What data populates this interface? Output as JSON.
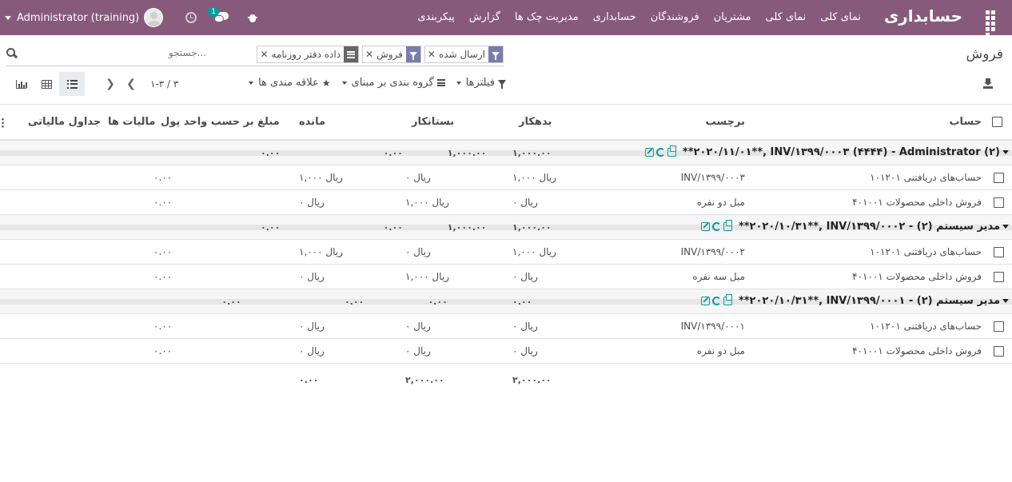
{
  "navbar": {
    "brand": "حسابداری",
    "menu": [
      "نمای کلی",
      "نمای کلی",
      "مشتریان",
      "فروشندگان",
      "حسابداری",
      "مدیریت چک ها",
      "گزارش",
      "پیکربندی"
    ],
    "user_name": "Administrator (training)",
    "chat_badge": "1",
    "brand_color": "#875a7b"
  },
  "control": {
    "breadcrumb": "فروش",
    "search_placeholder": "جستجو...",
    "facets": [
      {
        "type": "filter",
        "value": "ارسال شده"
      },
      {
        "type": "filter",
        "value": "فروش"
      },
      {
        "type": "groupby",
        "value": "داده دفتر روزنامه"
      }
    ],
    "filters_label": "فیلترها",
    "groupby_label": "گروه بندی بر مبنای",
    "favorites_label": "علاقه مندی ها",
    "pager_value": "۱-۳ / ۳"
  },
  "table": {
    "headers": {
      "account": "حساب",
      "label": "برچسب",
      "debit": "بدهکار",
      "credit": "بستانکار",
      "balance": "مانده",
      "amount_currency": "مبلغ بر حسب واحد پول",
      "taxes": "مالیات ها",
      "tax_grids": "جداول مالیاتی"
    },
    "groups": [
      {
        "title": "**۲۰۲۰/۱۱/۰۱**, INV/۱۳۹۹/۰۰۰۳ (۴۴۴۴) - Administrator (۲)",
        "debit": "۱,۰۰۰.۰۰",
        "credit": "۱,۰۰۰.۰۰",
        "balance": "۰.۰۰",
        "amount": "۰.۰۰",
        "rows": [
          {
            "account": "۱۰۱۲۰۱ حساب‌های دریافتنی",
            "label": "INV/۱۳۹۹/۰۰۰۳",
            "debit": "۱,۰۰۰ ریال",
            "credit": "۰ ریال",
            "balance": "۱,۰۰۰ ریال",
            "amount": "۰.۰۰"
          },
          {
            "account": "۴۰۱۰۰۱ فروش داخلی محصولات",
            "label": "مبل دو نفره",
            "debit": "۰ ریال",
            "credit": "۱,۰۰۰ ریال",
            "balance": "۰ ریال",
            "amount": "۰.۰۰"
          }
        ]
      },
      {
        "title": "**۲۰۲۰/۱۰/۳۱**, INV/۱۳۹۹/۰۰۰۲ - مدیر سیستم (۲)",
        "debit": "۱,۰۰۰.۰۰",
        "credit": "۱,۰۰۰.۰۰",
        "balance": "۰.۰۰",
        "amount": "۰.۰۰",
        "rows": [
          {
            "account": "۱۰۱۲۰۱ حساب‌های دریافتنی",
            "label": "INV/۱۳۹۹/۰۰۰۲",
            "debit": "۱,۰۰۰ ریال",
            "credit": "۰ ریال",
            "balance": "۱,۰۰۰ ریال",
            "amount": "۰.۰۰"
          },
          {
            "account": "۴۰۱۰۰۱ فروش داخلی محصولات",
            "label": "مبل سه نفره",
            "debit": "۰ ریال",
            "credit": "۱,۰۰۰ ریال",
            "balance": "۰ ریال",
            "amount": "۰.۰۰"
          }
        ]
      },
      {
        "title": "**۲۰۲۰/۱۰/۳۱**, INV/۱۳۹۹/۰۰۰۱ - مدیر سیستم (۲)",
        "debit": "۰.۰۰",
        "credit": "۰.۰۰",
        "balance": "۰.۰۰",
        "amount": "۰.۰۰",
        "rows": [
          {
            "account": "۱۰۱۲۰۱ حساب‌های دریافتنی",
            "label": "INV/۱۳۹۹/۰۰۰۱",
            "debit": "۰ ریال",
            "credit": "۰ ریال",
            "balance": "۰ ریال",
            "amount": "۰.۰۰"
          },
          {
            "account": "۴۰۱۰۰۱ فروش داخلی محصولات",
            "label": "مبل دو نفره",
            "debit": "۰ ریال",
            "credit": "۰ ریال",
            "balance": "۰ ریال",
            "amount": "۰.۰۰"
          }
        ]
      }
    ],
    "totals": {
      "debit": "۲,۰۰۰.۰۰",
      "credit": "۲,۰۰۰.۰۰",
      "balance": "۰.۰۰"
    }
  }
}
